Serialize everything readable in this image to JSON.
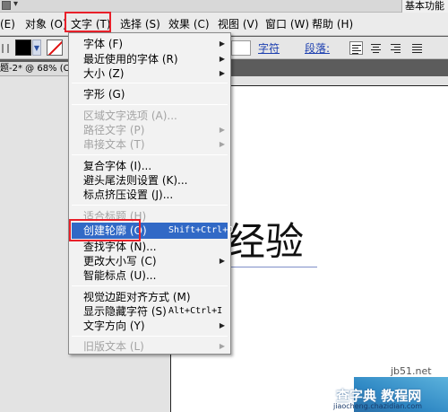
{
  "titlebar": {
    "workspace": "基本功能"
  },
  "menubar": {
    "items": [
      "(E)",
      "对象 (O)",
      "文字 (T)",
      "选择 (S)",
      "效果 (C)",
      "视图 (V)",
      "窗口 (W)",
      "帮助 (H)"
    ]
  },
  "control_bar": {
    "links": [
      "字符",
      "段落:"
    ],
    "colors": {
      "fill": "#000000",
      "stroke": "#ffffff",
      "stroke_slash": "#e01010",
      "link": "#1c3fb0"
    }
  },
  "document": {
    "tab_label": "题-2* @ 68% (C",
    "canvas_text": "经验"
  },
  "dropdown": {
    "items": [
      {
        "label": "字体 (F)",
        "submenu": true,
        "disabled": false
      },
      {
        "label": "最近使用的字体 (R)",
        "submenu": true,
        "disabled": false
      },
      {
        "label": "大小 (Z)",
        "submenu": true,
        "disabled": false
      },
      {
        "label": "字形 (G)",
        "submenu": false,
        "disabled": false
      },
      {
        "label": "区域文字选项 (A)...",
        "submenu": false,
        "disabled": true
      },
      {
        "label": "路径文字 (P)",
        "submenu": true,
        "disabled": true
      },
      {
        "label": "串接文本 (T)",
        "submenu": true,
        "disabled": true
      },
      {
        "label": "复合字体 (I)...",
        "submenu": false,
        "disabled": false
      },
      {
        "label": "避头尾法则设置 (K)...",
        "submenu": false,
        "disabled": false
      },
      {
        "label": "标点挤压设置 (J)...",
        "submenu": false,
        "disabled": false
      },
      {
        "label": "适合标题 (H)",
        "submenu": false,
        "disabled": true
      },
      {
        "label": "创建轮廓 (O)",
        "submenu": false,
        "disabled": false,
        "shortcut": "Shift+Ctrl+O",
        "selected": true
      },
      {
        "label": "查找字体 (N)...",
        "submenu": false,
        "disabled": false
      },
      {
        "label": "更改大小写 (C)",
        "submenu": true,
        "disabled": false
      },
      {
        "label": "智能标点 (U)...",
        "submenu": false,
        "disabled": false
      },
      {
        "label": "视觉边距对齐方式 (M)",
        "submenu": false,
        "disabled": false
      },
      {
        "label": "显示隐藏字符 (S)",
        "submenu": false,
        "disabled": false,
        "shortcut": "Alt+Ctrl+I"
      },
      {
        "label": "文字方向 (Y)",
        "submenu": true,
        "disabled": false
      },
      {
        "label": "旧版文本 (L)",
        "submenu": true,
        "disabled": true
      }
    ],
    "selection_color": "#3169c6"
  },
  "annotations": {
    "highlight_color": "#e8202a"
  },
  "watermark": {
    "site": "jb51.net",
    "logo": "查字典 教程网",
    "url": "jiaocheng.chazidian.com"
  }
}
